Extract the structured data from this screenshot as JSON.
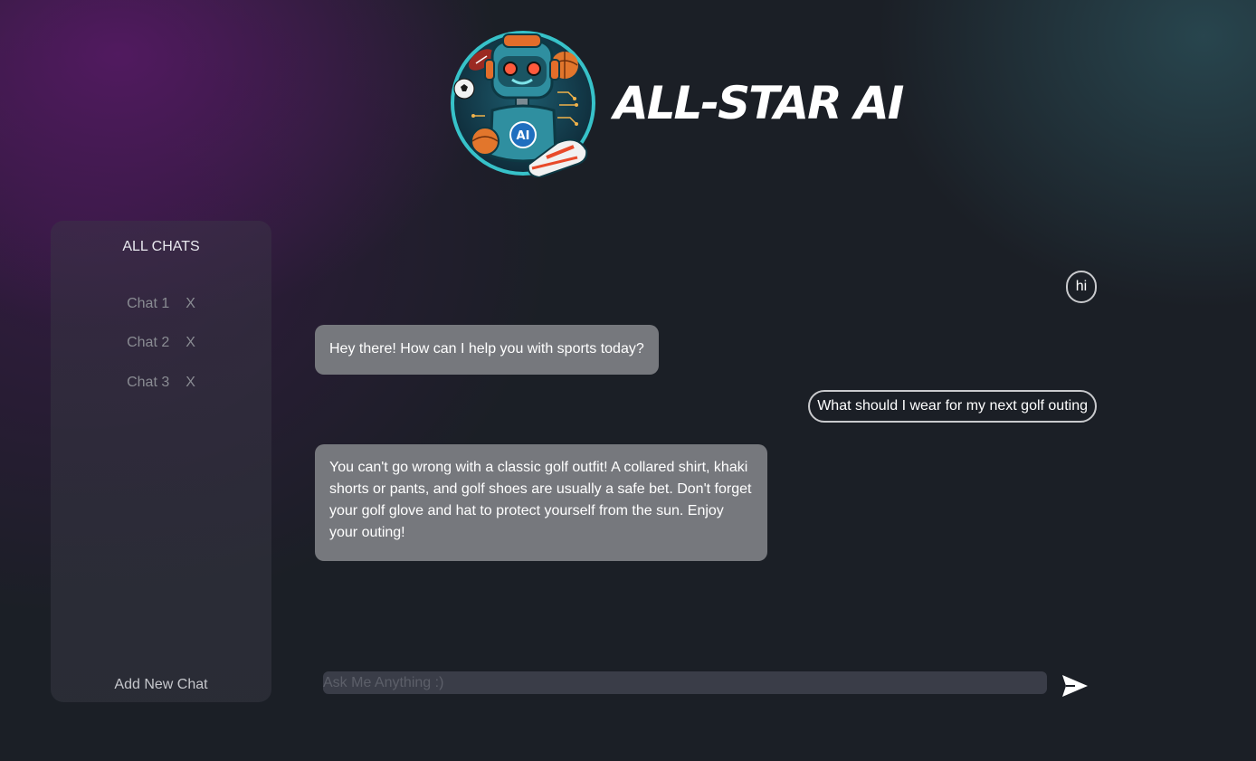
{
  "header": {
    "title": "ALL-STAR AI",
    "logo_icon": "robot-athlete-logo-icon",
    "logo_badge": "AI"
  },
  "sidebar": {
    "title": "ALL CHATS",
    "items": [
      {
        "label": "Chat 1",
        "close": "X"
      },
      {
        "label": "Chat 2",
        "close": "X"
      },
      {
        "label": "Chat 3",
        "close": "X"
      }
    ],
    "add_label": "Add New Chat"
  },
  "messages": [
    {
      "role": "user",
      "text": "hi"
    },
    {
      "role": "bot",
      "text": "Hey there! How can I help you with sports today?"
    },
    {
      "role": "user",
      "text": "What should I wear for my next golf outing"
    },
    {
      "role": "bot",
      "text": "You can't go wrong with a classic golf outfit! A collared shirt, khaki shorts or pants, and golf shoes are usually a safe bet. Don't forget your golf glove and hat to protect yourself from the sun. Enjoy your outing!"
    }
  ],
  "input": {
    "placeholder": "Ask Me Anything :)",
    "value": "",
    "send_icon": "send-icon"
  },
  "colors": {
    "background": "#1b1f26",
    "bot_bubble": "#76787d",
    "user_bubble_border": "#c9cacd",
    "input_bg": "#3a3d48",
    "accent_purple": "#5f196e",
    "accent_teal": "#32646e"
  }
}
